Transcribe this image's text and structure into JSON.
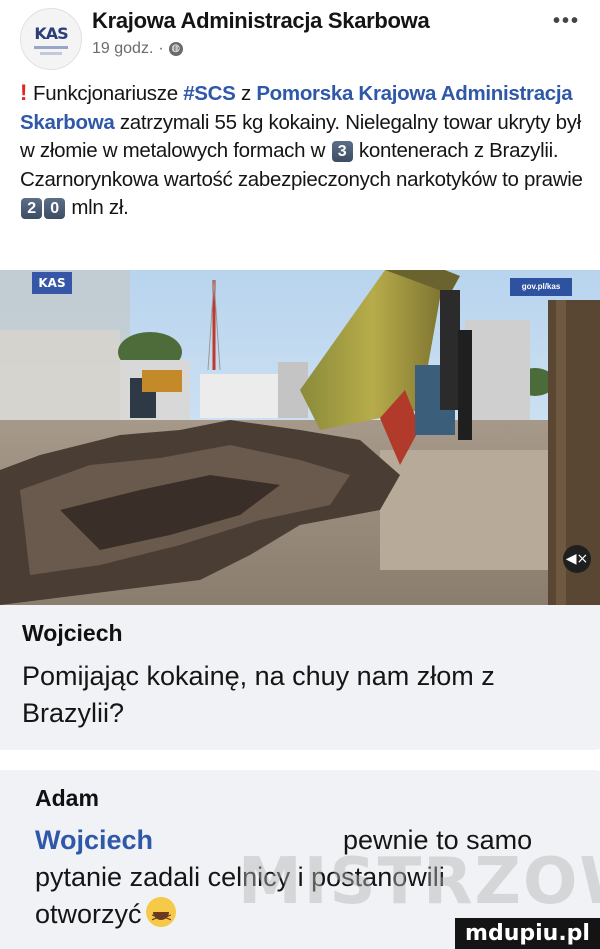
{
  "post": {
    "page_name": "Krajowa Administracja Skarbowa",
    "time": "19 godz.",
    "more_label": "•••",
    "avatar_logo": "KAS",
    "text": {
      "excl": "!",
      "l1_pre": "Funkcjonariusze ",
      "hashtag": "#SCS",
      "l1_mid": " z ",
      "org": "Pomorska Krajowa Administracja Skarbowa",
      "l2_post": " zatrzymali 55 kg kokainy. Nielegalny towar ukryty był w złomie w metalowych formach w ",
      "num_containers": "3",
      "l3_post": " kontenerach z Brazylii. Czarnorynkowa wartość zabezpieczonych narkotyków to prawie ",
      "value_digit1": "2",
      "value_digit2": "0",
      "l4_post": " mln  zł."
    }
  },
  "photo": {
    "badge_left": "KAS",
    "badge_right": "gov.pl/kas",
    "mute_icon": "speaker-mute-icon",
    "mute_glyph": "◀×"
  },
  "comments": [
    {
      "author": "Wojciech",
      "text_line1": "Pomijając kokainę, na chuy nam złom z",
      "text_line2": "Brazylii?"
    },
    {
      "author": "Adam",
      "mention": "Wojciech",
      "text_line1_post": "pewnie to samo",
      "text_line2": "pytanie zadali celnicy i postanowili",
      "text_line3": "otworzyć"
    }
  ],
  "watermarks": {
    "mid": "MISTRZOWIE",
    "site": "mdupiu.pl"
  },
  "colors": {
    "link": "#2f58a8",
    "exclamation": "#e3251f",
    "comment_bg": "#f0f2f5"
  }
}
